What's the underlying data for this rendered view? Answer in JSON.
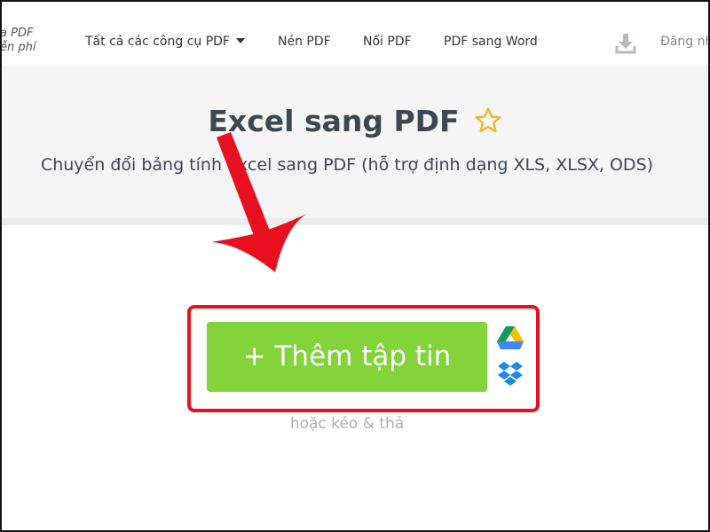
{
  "header": {
    "logo_line1": "a PDF",
    "logo_line2": "ễn phí",
    "nav_items": [
      {
        "label": "Tất cả các công cụ PDF"
      },
      {
        "label": "Nén PDF"
      },
      {
        "label": "Nối PDF"
      },
      {
        "label": "PDF sang Word"
      }
    ],
    "signin_label": "Đăng nh"
  },
  "hero": {
    "title": "Excel sang PDF",
    "subtitle": "Chuyển đổi bảng tính Excel sang PDF (hỗ trợ định dạng XLS, XLSX, ODS)"
  },
  "upload": {
    "add_button_label": "+ Thêm tập tin",
    "drag_text": "hoặc kéo & thả"
  },
  "icons": {
    "dropdown": "caret-down-icon",
    "download": "download-icon",
    "favorite": "star-icon",
    "google_drive": "google-drive-icon",
    "dropbox": "dropbox-icon"
  },
  "colors": {
    "add_button": "#83d43a",
    "annotation_red": "#e8101e",
    "star": "#f2b824",
    "title_text": "#3d4750"
  }
}
